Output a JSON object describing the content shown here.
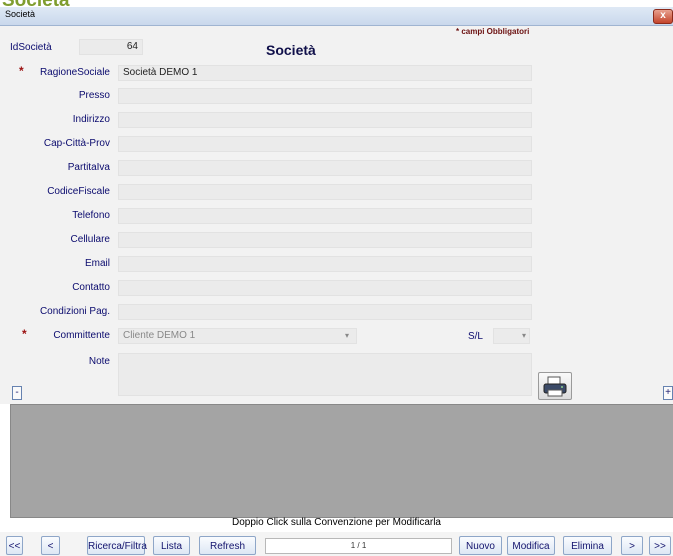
{
  "background_title": "Società",
  "window": {
    "title": "Società",
    "close_label": "x"
  },
  "form": {
    "heading": "Società",
    "required_note": "* campi Obbligatori",
    "id_label": "IdSocietà",
    "id_value": "64",
    "fields": [
      {
        "label": "RagioneSociale",
        "value": "Società DEMO 1",
        "required": true
      },
      {
        "label": "Presso",
        "value": ""
      },
      {
        "label": "Indirizzo",
        "value": ""
      },
      {
        "label": "Cap-Città-Prov",
        "value": ""
      },
      {
        "label": "PartitaIva",
        "value": ""
      },
      {
        "label": "CodiceFiscale",
        "value": ""
      },
      {
        "label": "Telefono",
        "value": ""
      },
      {
        "label": "Cellulare",
        "value": ""
      },
      {
        "label": "Email",
        "value": ""
      },
      {
        "label": "Contatto",
        "value": ""
      },
      {
        "label": "Condizioni Pag.",
        "value": ""
      }
    ],
    "committente_label": "Committente",
    "committente_value": "Cliente DEMO 1",
    "sl_label": "S/L",
    "sl_value": "",
    "note_label": "Note",
    "note_value": "",
    "collapse_label": "-",
    "expand_label": "+"
  },
  "status_text": "Doppio Click sulla Convenzione per Modificarla",
  "nav": {
    "first": "<<",
    "prev": "<",
    "search": "Ricerca/Filtra",
    "list": "Lista",
    "refresh": "Refresh",
    "page": "1 / 1",
    "new": "Nuovo",
    "edit": "Modifica",
    "delete": "Elimina",
    "next": ">",
    "last": ">>"
  },
  "icons": {
    "print": "printer-icon",
    "dropdown": "chevron-down-icon"
  }
}
